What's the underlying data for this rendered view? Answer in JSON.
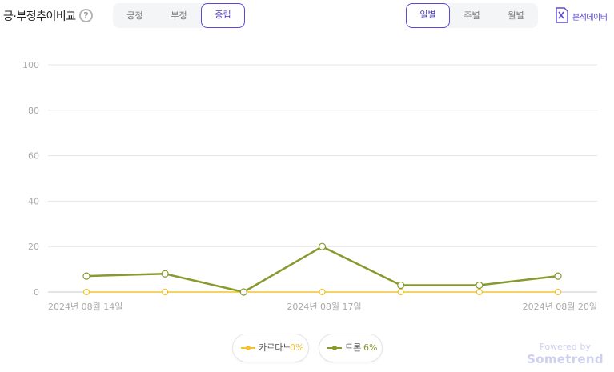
{
  "header": {
    "title": "긍·부정추이비교",
    "help_glyph": "?",
    "sentiment_tabs": [
      {
        "label": "긍정",
        "active": false
      },
      {
        "label": "부정",
        "active": false
      },
      {
        "label": "중립",
        "active": true
      }
    ],
    "period_tabs": [
      {
        "label": "일별",
        "active": true
      },
      {
        "label": "주별",
        "active": false
      },
      {
        "label": "월별",
        "active": false
      }
    ],
    "analysis_label": "분석데이터",
    "analysis_icon": "excel-icon"
  },
  "chart_data": {
    "type": "line",
    "x": [
      "2024년 08월 14일",
      "2024년 08월 15일",
      "2024년 08월 16일",
      "2024년 08월 17일",
      "2024년 08월 18일",
      "2024년 08월 19일",
      "2024년 08월 20일"
    ],
    "x_tick_labels": [
      "2024년 08월 14일",
      "2024년 08월 17일",
      "2024년 08월 20일"
    ],
    "y_tick_labels": [
      "0",
      "20",
      "40",
      "60",
      "80",
      "100"
    ],
    "ylim": [
      0,
      100
    ],
    "grid": true,
    "legend_position": "bottom",
    "series": [
      {
        "name": "카르다노",
        "percent_label": "0%",
        "color": "#f2c234",
        "values": [
          0,
          0,
          0,
          0,
          0,
          0,
          0
        ]
      },
      {
        "name": "트론",
        "percent_label": "6%",
        "color": "#879a2e",
        "values": [
          7,
          8,
          0,
          20,
          3,
          3,
          7
        ]
      }
    ]
  },
  "footer": {
    "powered_line1": "Powered by",
    "powered_line2": "Sometrend"
  }
}
